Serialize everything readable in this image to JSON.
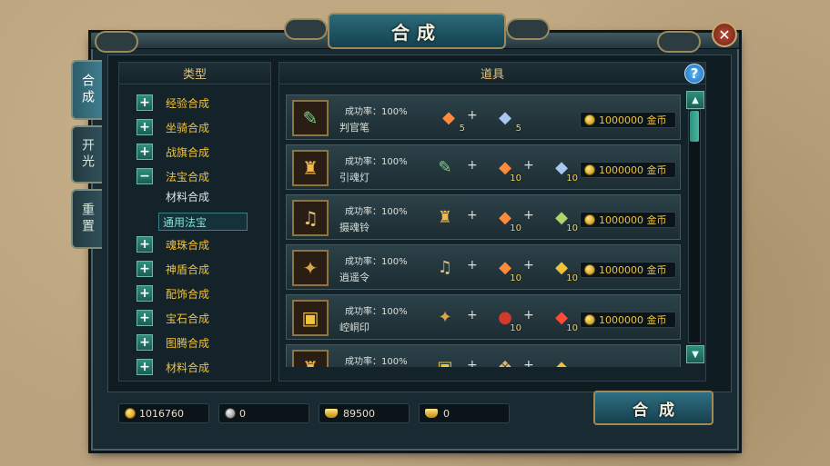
{
  "window": {
    "title": "合成",
    "close_label": "✕"
  },
  "side_tabs": [
    {
      "label": "合成",
      "active": true
    },
    {
      "label": "开光",
      "active": false
    },
    {
      "label": "重置",
      "active": false
    }
  ],
  "types_panel": {
    "header": "类型",
    "categories": [
      {
        "label": "经验合成",
        "expanded": false
      },
      {
        "label": "坐骑合成",
        "expanded": false
      },
      {
        "label": "战旗合成",
        "expanded": false
      },
      {
        "label": "法宝合成",
        "expanded": true,
        "children": [
          {
            "label": "材料合成",
            "selected": false
          },
          {
            "label": "通用法宝",
            "selected": true
          }
        ]
      },
      {
        "label": "魂珠合成",
        "expanded": false
      },
      {
        "label": "神盾合成",
        "expanded": false
      },
      {
        "label": "配饰合成",
        "expanded": false
      },
      {
        "label": "宝石合成",
        "expanded": false
      },
      {
        "label": "图腾合成",
        "expanded": false
      },
      {
        "label": "材料合成",
        "expanded": false
      }
    ]
  },
  "items_panel": {
    "header": "道具",
    "help_label": "?",
    "rows": [
      {
        "name": "判官笔",
        "rate": "成功率：100%",
        "icon": "brush-icon",
        "materials": [
          {
            "icon": "orange-crystal-icon",
            "count": "5"
          },
          {
            "icon": "blue-crystal-icon",
            "count": "5"
          }
        ],
        "cost": "1000000 金币"
      },
      {
        "name": "引魂灯",
        "rate": "成功率：100%",
        "icon": "lantern-icon",
        "materials": [
          {
            "icon": "brush-icon",
            "count": ""
          },
          {
            "icon": "orange-crystal-icon",
            "count": "10"
          },
          {
            "icon": "blue-crystal-icon",
            "count": "10"
          }
        ],
        "cost": "1000000 金币"
      },
      {
        "name": "摄魂铃",
        "rate": "成功率：100%",
        "icon": "bell-icon",
        "materials": [
          {
            "icon": "lantern-icon",
            "count": ""
          },
          {
            "icon": "orange-crystal-icon",
            "count": "10"
          },
          {
            "icon": "green-crystal-icon",
            "count": "10"
          }
        ],
        "cost": "1000000 金币"
      },
      {
        "name": "逍遥令",
        "rate": "成功率：100%",
        "icon": "token-icon",
        "materials": [
          {
            "icon": "bell-icon",
            "count": ""
          },
          {
            "icon": "orange-crystal-icon",
            "count": "10"
          },
          {
            "icon": "gold-crystal-icon",
            "count": "10"
          }
        ],
        "cost": "1000000 金币"
      },
      {
        "name": "崆峒印",
        "rate": "成功率：100%",
        "icon": "seal-icon",
        "materials": [
          {
            "icon": "token-icon",
            "count": ""
          },
          {
            "icon": "red-orb-icon",
            "count": "10"
          },
          {
            "icon": "red-crystal-icon",
            "count": "10"
          }
        ],
        "cost": "1000000 金币"
      },
      {
        "name": "",
        "rate": "成功率：100%",
        "icon": "lantern-icon",
        "materials": [
          {
            "icon": "seal-icon",
            "count": ""
          },
          {
            "icon": "dragon-icon",
            "count": ""
          },
          {
            "icon": "gold-crystal-icon",
            "count": ""
          }
        ],
        "cost": ""
      }
    ]
  },
  "currency_bar": [
    {
      "icon": "gold-coin-icon",
      "value": "1016760"
    },
    {
      "icon": "silver-coin-icon",
      "value": "0"
    },
    {
      "icon": "gold-ingot-icon",
      "value": "89500"
    },
    {
      "icon": "bound-ingot-icon",
      "value": "0"
    }
  ],
  "actions": {
    "synthesize_label": "合成"
  }
}
